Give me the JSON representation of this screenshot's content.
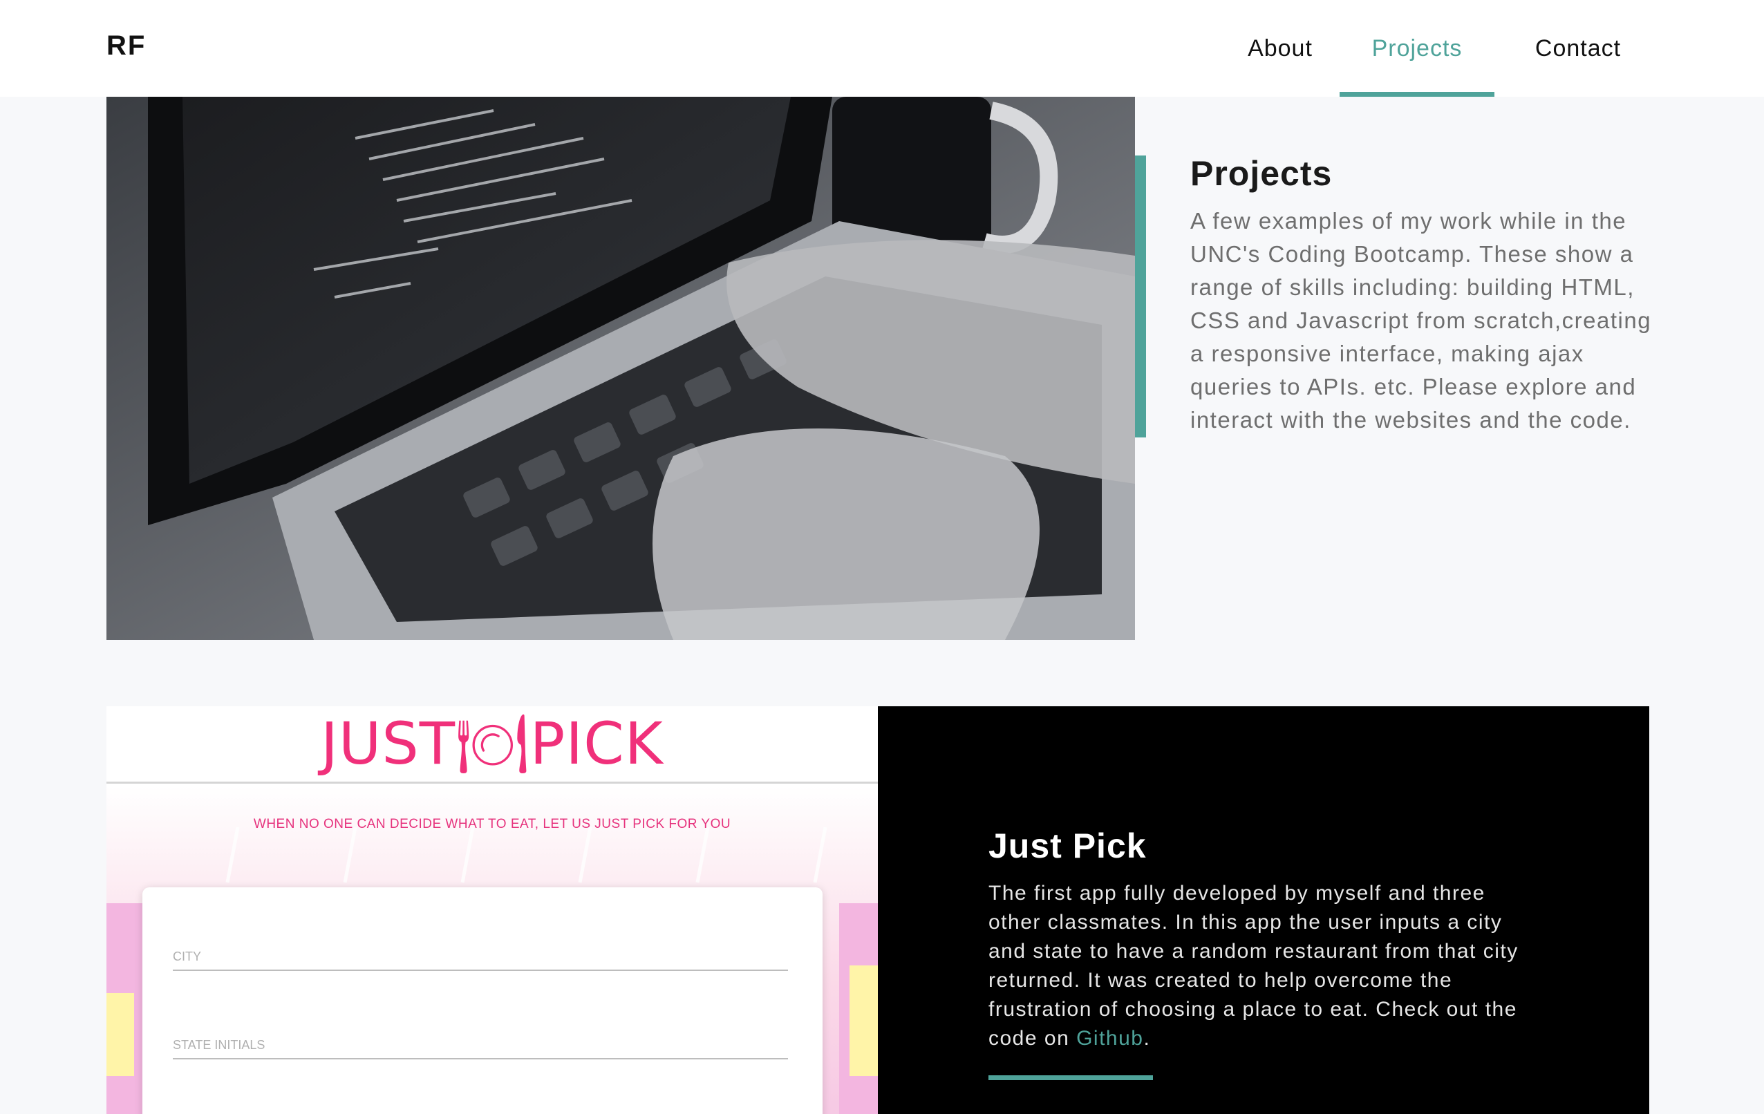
{
  "nav": {
    "logo": "RF",
    "links": [
      {
        "label": "About",
        "active": false
      },
      {
        "label": "Projects",
        "active": true
      },
      {
        "label": "Contact",
        "active": false
      }
    ]
  },
  "intro": {
    "title": "Projects",
    "body": "A few examples of my work while in the UNC's Coding Bootcamp. These show a range of skills including: building HTML, CSS and Javascript from scratch,creating a responsive interface, making ajax queries to APIs. etc. Please explore and interact with the websites and the code."
  },
  "project": {
    "screenshot": {
      "logo_text": "JUST🍽PICK",
      "tagline": "WHEN NO ONE CAN DECIDE WHAT TO EAT, LET US JUST PICK FOR YOU",
      "city_placeholder": "CITY",
      "state_placeholder": "STATE INITIALS"
    },
    "title": "Just Pick",
    "body_before_link": "The first app fully developed by myself and three other classmates. In this app the user inputs a city and state to have a random restaurant from that city returned. It was created to help overcome the frustration of choosing a place to eat. Check out the code on ",
    "link_label": "Github",
    "body_after_link": "."
  },
  "colors": {
    "accent": "#4fa39a",
    "brand_pink": "#f0307a"
  }
}
